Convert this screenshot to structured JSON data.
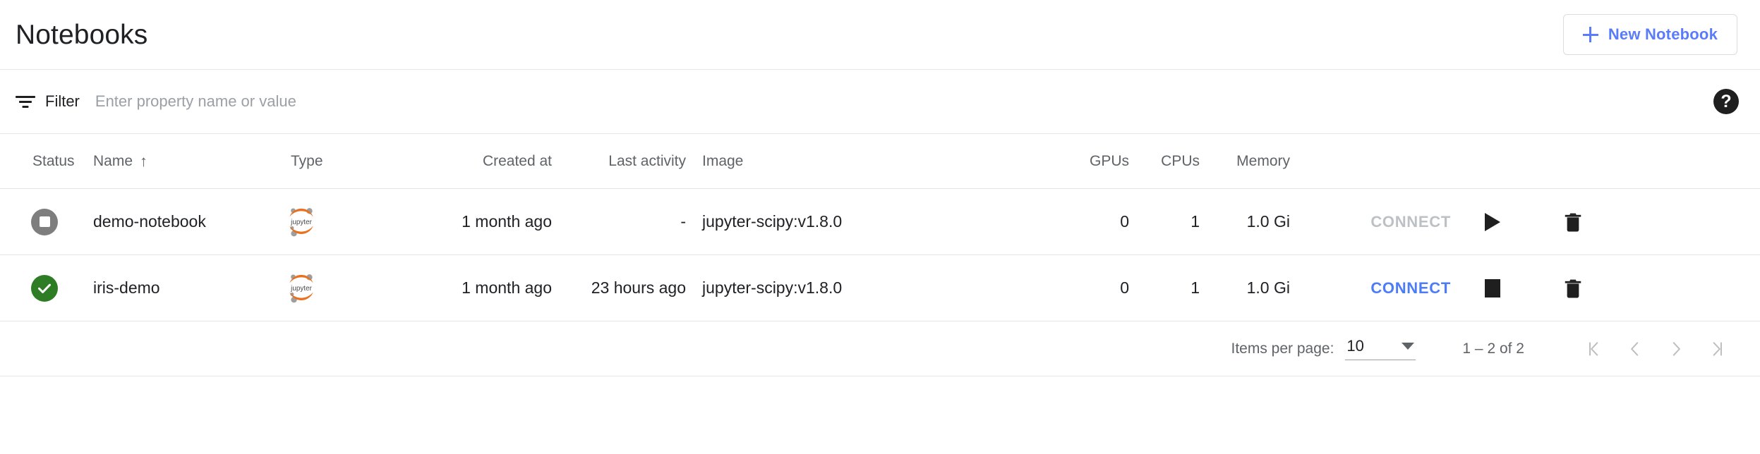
{
  "header": {
    "title": "Notebooks",
    "new_notebook_label": "New Notebook",
    "plus_icon": "plus-icon"
  },
  "filter": {
    "icon": "filter-icon",
    "label": "Filter",
    "placeholder": "Enter property name or value",
    "value": "",
    "help_icon": "help-icon",
    "help_glyph": "?"
  },
  "colors": {
    "accent_blue": "#4c7cf8",
    "button_blue": "#5b7cfa",
    "status_ready_green": "#2e7d24",
    "status_stopped_gray": "#7e7e7e",
    "jupyter_orange": "#e8701e",
    "disabled_gray": "#bdc1c6",
    "divider": "#e4e4e4",
    "header_text": "#5f6368"
  },
  "table": {
    "columns": [
      {
        "key": "status",
        "label": "Status"
      },
      {
        "key": "name",
        "label": "Name",
        "sorted": true,
        "sort_arrow": "↑"
      },
      {
        "key": "type",
        "label": "Type"
      },
      {
        "key": "created",
        "label": "Created at"
      },
      {
        "key": "activity",
        "label": "Last activity"
      },
      {
        "key": "image",
        "label": "Image"
      },
      {
        "key": "gpus",
        "label": "GPUs"
      },
      {
        "key": "cpus",
        "label": "CPUs"
      },
      {
        "key": "memory",
        "label": "Memory"
      }
    ],
    "rows": [
      {
        "status_icon": "status-stopped-icon",
        "status_value": "Stopped",
        "name": "demo-notebook",
        "type_icon": "jupyter-logo-icon",
        "type_value": "jupyter",
        "created": "1 month ago",
        "activity": "-",
        "image": "jupyter-scipy:v1.8.0",
        "gpus": "0",
        "cpus": "1",
        "memory": "1.0 Gi",
        "connect_label": "CONNECT",
        "connect_enabled": false,
        "action_icon": "play-icon",
        "delete_icon": "trash-icon"
      },
      {
        "status_icon": "status-ready-icon",
        "status_value": "Running",
        "name": "iris-demo",
        "type_icon": "jupyter-logo-icon",
        "type_value": "jupyter",
        "created": "1 month ago",
        "activity": "23 hours ago",
        "image": "jupyter-scipy:v1.8.0",
        "gpus": "0",
        "cpus": "1",
        "memory": "1.0 Gi",
        "connect_label": "CONNECT",
        "connect_enabled": true,
        "action_icon": "stop-icon",
        "delete_icon": "trash-icon"
      }
    ]
  },
  "paginator": {
    "items_per_page_label": "Items per page:",
    "items_per_page_value": "10",
    "range_label": "1 – 2 of 2",
    "first_page_icon": "first-page-icon",
    "prev_page_icon": "previous-page-icon",
    "next_page_icon": "next-page-icon",
    "last_page_icon": "last-page-icon"
  }
}
